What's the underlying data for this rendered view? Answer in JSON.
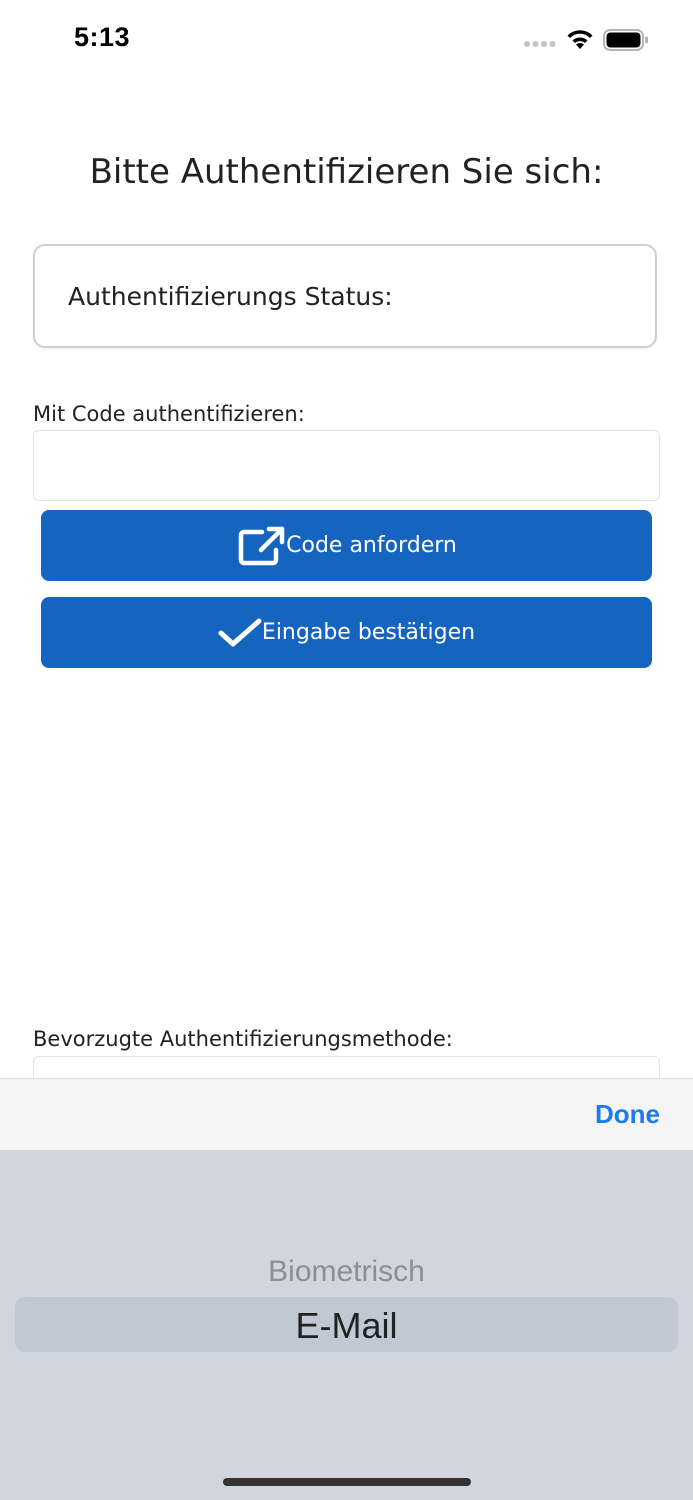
{
  "status_bar": {
    "time": "5:13",
    "icons": [
      "signal-dots-icon",
      "wifi-icon",
      "battery-icon"
    ]
  },
  "header": {
    "title": "Bitte Authentifizieren Sie sich:"
  },
  "status_box": {
    "label": "Authentifizierungs Status:"
  },
  "code_section": {
    "label": "Mit Code authentifizieren:",
    "input_value": ""
  },
  "buttons": {
    "request_code": {
      "label": "Code anfordern",
      "icon": "external-link-icon"
    },
    "confirm": {
      "label": "Eingabe bestätigen",
      "icon": "checkmark-icon"
    }
  },
  "method_section": {
    "label": "Bevorzugte Authentifizierungsmethode:"
  },
  "picker": {
    "done_label": "Done",
    "options": [
      "Biometrisch",
      "E-Mail"
    ],
    "selected": "E-Mail"
  },
  "colors": {
    "button_bg": "#1565c0",
    "done_blue": "#1a7cf0",
    "picker_bg": "#d1d5dd"
  }
}
